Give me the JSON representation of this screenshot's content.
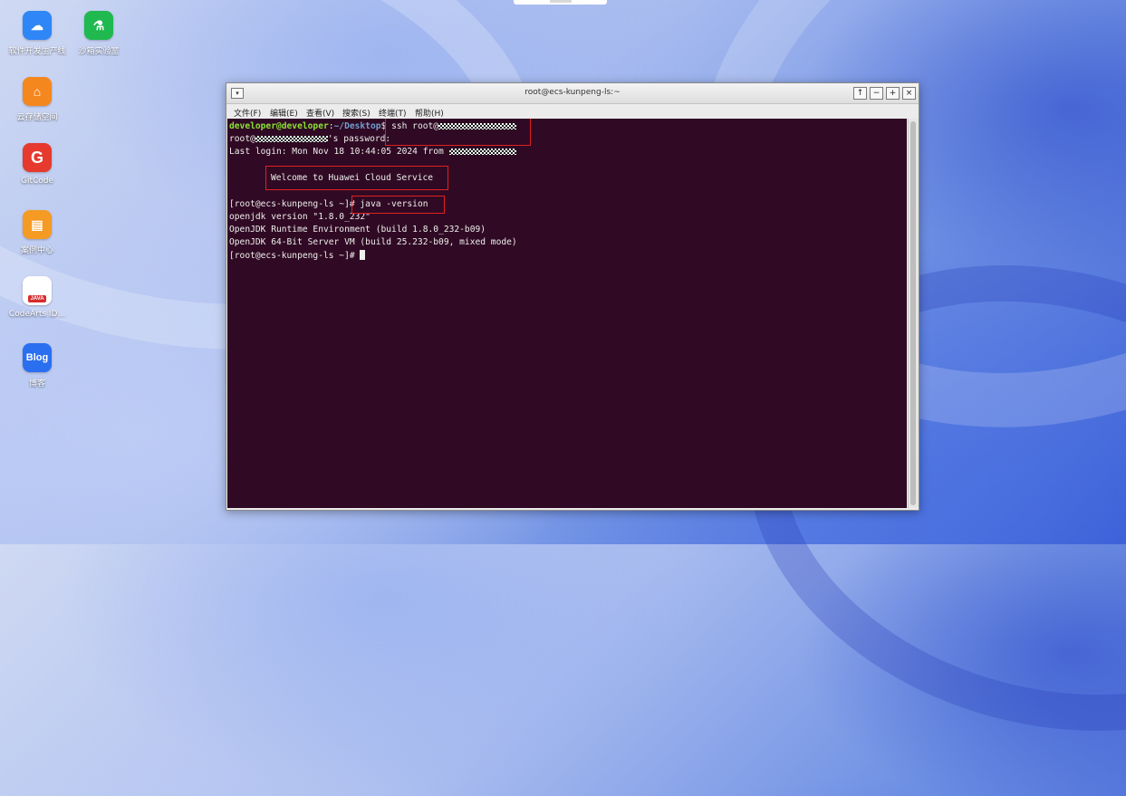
{
  "desktop": {
    "icons": [
      {
        "label": "软件开发生产线",
        "glyph": "☁",
        "color": "#2f86f6",
        "icon": "cloud-devops-icon"
      },
      {
        "label": "沙箱实验室",
        "glyph": "⚗",
        "color": "#1fb94f",
        "icon": "flask-lab-icon"
      },
      {
        "label": "云存储空间",
        "glyph": "⌂",
        "color": "#f5871f",
        "icon": "cloud-storage-icon"
      },
      {
        "label": "GitCode",
        "glyph": "G",
        "color": "#e63a2e",
        "icon": "gitcode-icon"
      },
      {
        "label": "案例中心",
        "glyph": "▤",
        "color": "#f59a23",
        "icon": "case-center-icon"
      },
      {
        "label": "CodeArts ID...",
        "glyph": "JAVA",
        "color": "#ffffff",
        "icon": "codearts-java-icon"
      },
      {
        "label": "博客",
        "glyph": "Blog",
        "color": "#2a6ff0",
        "icon": "blog-icon"
      }
    ]
  },
  "window": {
    "title": "root@ecs-kunpeng-ls:~",
    "menu_glyph": "▾",
    "buttons": {
      "up": "↑",
      "minimize": "−",
      "maximize": "+",
      "close": "×"
    },
    "menu": [
      "文件(F)",
      "编辑(E)",
      "查看(V)",
      "搜索(S)",
      "终端(T)",
      "帮助(H)"
    ]
  },
  "terminal": {
    "prompt_user": "developer@developer",
    "prompt_sep": ":",
    "prompt_path": "~/Desktop",
    "prompt_end": "$ ",
    "cmd_ssh": "ssh root@",
    "pw_prefix": "root@",
    "pw_suffix": "'s password:",
    "last_login": "Last login: Mon Nov 18 10:44:05 2024 from ",
    "welcome": "Welcome to Huawei Cloud Service",
    "root_prompt": "[root@ecs-kunpeng-ls ~]# ",
    "cmd_java": "java -version",
    "out1": "openjdk version \"1.8.0_232\"",
    "out2": "OpenJDK Runtime Environment (build 1.8.0_232-b09)",
    "out3": "OpenJDK 64-Bit Server VM (build 25.232-b09, mixed mode)"
  },
  "colors": {
    "terminal_bg": "#300a24",
    "prompt_green": "#8ae234",
    "prompt_blue": "#729fcf",
    "highlight_red": "#e02020"
  }
}
